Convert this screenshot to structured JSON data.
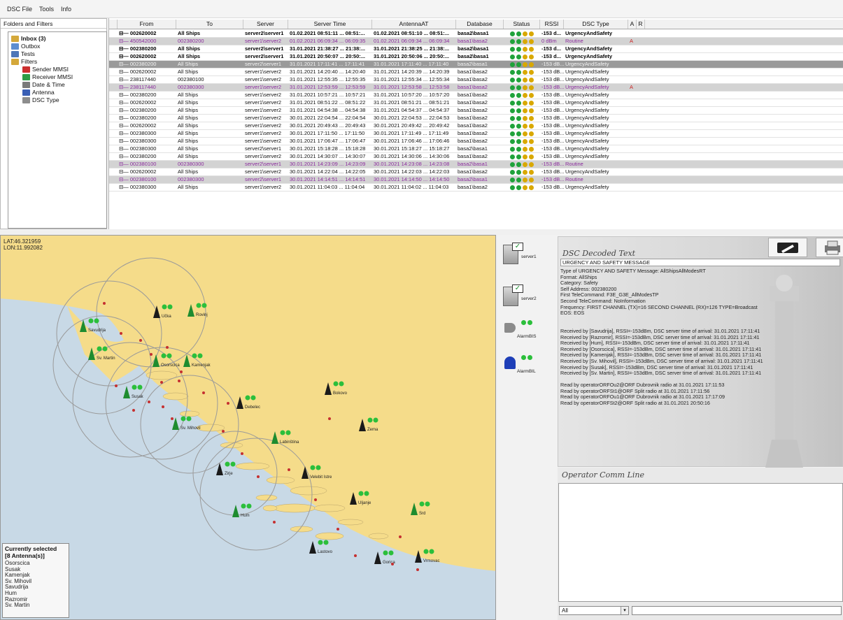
{
  "menu": [
    "DSC File",
    "Tools",
    "Info"
  ],
  "tree": {
    "header": "Folders and Filters",
    "items": [
      {
        "label": "Inbox (3)",
        "bold": true,
        "indent": 0,
        "icon": "folder-icon",
        "color": "#d4a83a"
      },
      {
        "label": "Outbox",
        "bold": false,
        "indent": 0,
        "icon": "outbox-icon",
        "color": "#5d8ed1"
      },
      {
        "label": "Tests",
        "bold": false,
        "indent": 0,
        "icon": "tests-icon",
        "color": "#4e76b8"
      },
      {
        "label": "Filters",
        "bold": false,
        "indent": 0,
        "icon": "filter-icon",
        "color": "#d4a83a"
      },
      {
        "label": "Sender MMSI",
        "bold": false,
        "indent": 1,
        "icon": "anchor-icon",
        "color": "#cc3030"
      },
      {
        "label": "Receiver MMSI",
        "bold": false,
        "indent": 1,
        "icon": "anchor-icon",
        "color": "#2e9d46"
      },
      {
        "label": "Date & Time",
        "bold": false,
        "indent": 1,
        "icon": "clock-icon",
        "color": "#7a7a7a"
      },
      {
        "label": "Antenna",
        "bold": false,
        "indent": 1,
        "icon": "antenna-icon",
        "color": "#3a5fb5"
      },
      {
        "label": "DSC Type",
        "bold": false,
        "indent": 1,
        "icon": "tag-icon",
        "color": "#8d8d8d"
      }
    ]
  },
  "grid": {
    "columns": [
      "",
      "From",
      "To",
      "Server",
      "Server Time",
      "AntennaAT",
      "Database",
      "Status",
      "RSSI",
      "DSC Type",
      "A",
      "R"
    ],
    "rows": [
      {
        "style": "bold",
        "from": "002620002",
        "to": "All Ships",
        "server": "server2\\server1",
        "stime": "01.02.2021 08:51:11 ... 08:51:...",
        "atime": "01.02.2021 08:51:10 ... 08:51:...",
        "db": "basa2\\basa1",
        "rssi": "-153 d...",
        "type": "UrgencyAndSafety",
        "a": ""
      },
      {
        "style": "purple",
        "from": "450542000",
        "to": "002380200",
        "server": "server1\\server2",
        "stime": "01.02.2021 06:09:34 ... 06:09:35",
        "atime": "01.02.2021 06:09:34 ... 06:09:34",
        "db": "basa1\\basa2",
        "rssi": "0 dBm",
        "type": "Routine",
        "a": "A"
      },
      {
        "style": "bold",
        "from": "002380200",
        "to": "All Ships",
        "server": "server2\\server1",
        "stime": "31.01.2021 21:38:27 ... 21:38:...",
        "atime": "31.01.2021 21:38:25 ... 21:38:...",
        "db": "basa2\\basa1",
        "rssi": "-153 d...",
        "type": "UrgencyAndSafety",
        "a": ""
      },
      {
        "style": "bold",
        "from": "002620002",
        "to": "All Ships",
        "server": "server2\\server1",
        "stime": "31.01.2021 20:50:07 ... 20:50:...",
        "atime": "31.01.2021 20:50:06 ... 20:50:...",
        "db": "basa2\\basa1",
        "rssi": "-153 d...",
        "type": "UrgencyAndSafety",
        "a": ""
      },
      {
        "style": "sel",
        "from": "002380200",
        "to": "All Ships",
        "server": "server2\\server1",
        "stime": "31.01.2021 17:11:41 ... 17:11:41",
        "atime": "31.01.2021 17:11:40 ... 17:11:40",
        "db": "basa2\\basa1",
        "rssi": "-153 dB...",
        "type": "UrgencyAndSafety",
        "a": ""
      },
      {
        "style": "",
        "from": "002620002",
        "to": "All Ships",
        "server": "server1\\server2",
        "stime": "31.01.2021 14:20:40 ... 14:20:40",
        "atime": "31.01.2021 14:20:39 ... 14:20:39",
        "db": "basa1\\basa2",
        "rssi": "-153 dB...",
        "type": "UrgencyAndSafety",
        "a": ""
      },
      {
        "style": "",
        "from": "238117440",
        "to": "002380100",
        "server": "server1\\server2",
        "stime": "31.01.2021 12:55:35 ... 12:55:35",
        "atime": "31.01.2021 12:55:34 ... 12:55:34",
        "db": "basa1\\basa2",
        "rssi": "-153 dB...",
        "type": "UrgencyAndSafety",
        "a": ""
      },
      {
        "style": "purple",
        "from": "238117440",
        "to": "002380300",
        "server": "server1\\server2",
        "stime": "31.01.2021 12:53:59 ... 12:53:59",
        "atime": "31.01.2021 12:53:58 ... 12:53:58",
        "db": "basa1\\basa2",
        "rssi": "-153 dB...",
        "type": "UrgencyAndSafety",
        "a": "A"
      },
      {
        "style": "",
        "from": "002380200",
        "to": "All Ships",
        "server": "server1\\server2",
        "stime": "31.01.2021 10:57:21 ... 10:57:21",
        "atime": "31.01.2021 10:57:20 ... 10:57:20",
        "db": "basa1\\basa2",
        "rssi": "-153 dB...",
        "type": "UrgencyAndSafety",
        "a": ""
      },
      {
        "style": "",
        "from": "002620002",
        "to": "All Ships",
        "server": "server1\\server2",
        "stime": "31.01.2021 08:51:22 ... 08:51:22",
        "atime": "31.01.2021 08:51:21 ... 08:51:21",
        "db": "basa1\\basa2",
        "rssi": "-153 dB...",
        "type": "UrgencyAndSafety",
        "a": ""
      },
      {
        "style": "",
        "from": "002380200",
        "to": "All Ships",
        "server": "server1\\server2",
        "stime": "31.01.2021 04:54:38 ... 04:54:38",
        "atime": "31.01.2021 04:54:37 ... 04:54:37",
        "db": "basa1\\basa2",
        "rssi": "-153 dB...",
        "type": "UrgencyAndSafety",
        "a": ""
      },
      {
        "style": "",
        "from": "002380200",
        "to": "All Ships",
        "server": "server1\\server2",
        "stime": "30.01.2021 22:04:54 ... 22:04:54",
        "atime": "30.01.2021 22:04:53 ... 22:04:53",
        "db": "basa1\\basa2",
        "rssi": "-153 dB...",
        "type": "UrgencyAndSafety",
        "a": ""
      },
      {
        "style": "",
        "from": "002620002",
        "to": "All Ships",
        "server": "server1\\server2",
        "stime": "30.01.2021 20:49:43 ... 20:49:43",
        "atime": "30.01.2021 20:49:42 ... 20:49:42",
        "db": "basa1\\basa2",
        "rssi": "-153 dB...",
        "type": "UrgencyAndSafety",
        "a": ""
      },
      {
        "style": "",
        "from": "002380300",
        "to": "All Ships",
        "server": "server1\\server2",
        "stime": "30.01.2021 17:11:50 ... 17:11:50",
        "atime": "30.01.2021 17:11:49 ... 17:11:49",
        "db": "basa1\\basa2",
        "rssi": "-153 dB...",
        "type": "UrgencyAndSafety",
        "a": ""
      },
      {
        "style": "",
        "from": "002380300",
        "to": "All Ships",
        "server": "server1\\server2",
        "stime": "30.01.2021 17:06:47 ... 17:06:47",
        "atime": "30.01.2021 17:06:46 ... 17:06:46",
        "db": "basa1\\basa2",
        "rssi": "-153 dB...",
        "type": "UrgencyAndSafety",
        "a": ""
      },
      {
        "style": "",
        "from": "002380300",
        "to": "All Ships",
        "server": "server2\\server1",
        "stime": "30.01.2021 15:18:28 ... 15:18:28",
        "atime": "30.01.2021 15:18:27 ... 15:18:27",
        "db": "basa2\\basa1",
        "rssi": "-153 dB...",
        "type": "UrgencyAndSafety",
        "a": ""
      },
      {
        "style": "",
        "from": "002380200",
        "to": "All Ships",
        "server": "server1\\server2",
        "stime": "30.01.2021 14:30:07 ... 14:30:07",
        "atime": "30.01.2021 14:30:06 ... 14:30:06",
        "db": "basa1\\basa2",
        "rssi": "-153 dB...",
        "type": "UrgencyAndSafety",
        "a": ""
      },
      {
        "style": "purple",
        "from": "002380100",
        "to": "002380300",
        "server": "server2\\server1",
        "stime": "30.01.2021 14:23:09 ... 14:23:09",
        "atime": "30.01.2021 14:23:08 ... 14:23:08",
        "db": "basa2\\basa1",
        "rssi": "-153 dB...",
        "type": "Routine",
        "a": ""
      },
      {
        "style": "",
        "from": "002620002",
        "to": "All Ships",
        "server": "server1\\server2",
        "stime": "30.01.2021 14:22:04 ... 14:22:05",
        "atime": "30.01.2021 14:22:03 ... 14:22:03",
        "db": "basa1\\basa2",
        "rssi": "-153 dB...",
        "type": "UrgencyAndSafety",
        "a": ""
      },
      {
        "style": "purple",
        "from": "002380100",
        "to": "002380300",
        "server": "server2\\server1",
        "stime": "30.01.2021 14:14:51 ... 14:14:51",
        "atime": "30.01.2021 14:14:50 ... 14:14:50",
        "db": "basa2\\basa1",
        "rssi": "-153 dB...",
        "type": "Routine",
        "a": ""
      },
      {
        "style": "",
        "from": "002380300",
        "to": "All Ships",
        "server": "server1\\server2",
        "stime": "30.01.2021 11:04:03 ... 11:04:04",
        "atime": "30.01.2021 11:04:02 ... 11:04:03",
        "db": "basa1\\basa2",
        "rssi": "-153 dB...",
        "type": "UrgencyAndSafety",
        "a": ""
      }
    ]
  },
  "map": {
    "lat": "LAT:46.321959",
    "lon": "LON:11.992082",
    "sea_color": "#c8d9e6",
    "land_color": "#f5dc8a",
    "antennas": [
      {
        "name": "Savudrija",
        "green": true
      },
      {
        "name": "Učka",
        "green": false
      },
      {
        "name": "Rovinj",
        "green": true
      },
      {
        "name": "Sv. Martin",
        "green": true
      },
      {
        "name": "Kamenjak",
        "green": true
      },
      {
        "name": "Osorscica",
        "green": true
      },
      {
        "name": "Susak",
        "green": true
      },
      {
        "name": "Sv. Mihovil",
        "green": true
      },
      {
        "name": "Debelec",
        "green": false
      },
      {
        "name": "Bokovo",
        "green": false
      },
      {
        "name": "Zema",
        "green": false
      },
      {
        "name": "Labinština",
        "green": true
      },
      {
        "name": "Zirje",
        "green": false
      },
      {
        "name": "Velebit Istre",
        "green": false
      },
      {
        "name": "Hum",
        "green": true
      },
      {
        "name": "Uljanje",
        "green": false
      },
      {
        "name": "Srd",
        "green": true
      },
      {
        "name": "Lastovo",
        "green": false
      },
      {
        "name": "Gorica",
        "green": false
      },
      {
        "name": "Vrmovac",
        "green": false
      }
    ],
    "legend_title": "Currently selected",
    "legend_count": "[8 Antenna(s)]",
    "legend_items": [
      "Osorscica",
      "Susak",
      "Kamenjak",
      "Sv. Mihovil",
      "Savudrija",
      "Hum",
      "Razromir",
      "Sv. Martin"
    ]
  },
  "devices": [
    {
      "label": "server1",
      "icon": "server-icon"
    },
    {
      "label": "server2",
      "icon": "server-icon"
    },
    {
      "label": "AlarmBIS",
      "icon": "speaker-icon"
    },
    {
      "label": "AlarmBIL",
      "icon": "alarm-light-icon"
    }
  ],
  "decoded": {
    "title": "DSC Decoded Text",
    "headline": "URGENCY AND SAFETY MESSAGE",
    "lines": [
      "Type of URGENCY AND SAFETY Message: AllShipsAllModesRT",
      "Format: AllShips",
      "Category: Safety",
      "Self Address: 002380200",
      "First TeleCommand: F3E_G3E_AllModesTP",
      "Second TeleCommand: NoInformation",
      "Frequency: FIRST CHANNEL (TX)=16 SECOND CHANNEL (RX)=126 TYPE=Broadcast",
      "EOS: EOS",
      "",
      "",
      "Received by [Savudrija], RSSI=-153dBm, DSC server time of arrival: 31.01.2021 17:11:41",
      "Received by [Razromir], RSSI=-153dBm, DSC server time of arrival: 31.01.2021 17:11:41",
      "Received by [Hum], RSSI=-153dBm, DSC server time of arrival: 31.01.2021 17:11:41",
      "Received by [Osorscica], RSSI=-153dBm, DSC server time of arrival: 31.01.2021 17:11:41",
      "Received by [Kamenjak], RSSI=-153dBm, DSC server time of arrival: 31.01.2021 17:11:41",
      "Received by [Sv. Mihovil], RSSI=-153dBm, DSC server time of arrival: 31.01.2021 17:11:41",
      "Received by [Susak], RSSI=-153dBm, DSC server time of arrival: 31.01.2021 17:11:41",
      "Received by [Sv. Martin], RSSI=-153dBm, DSC server time of arrival: 31.01.2021 17:11:41",
      "",
      "Read by operatorORFOu2@ORF Dubrovnik radio at 31.01.2021 17:11:53",
      "Read by operatorORFSt1@ORF Split radio at 31.01.2021 17:11:56",
      "Read by operatorORFOu1@ORF Dubrovnik radio at 31.01.2021 17:17:09",
      "Read by operatorORFSt2@ORF Split radio at 31.01.2021 20:50:16"
    ]
  },
  "ops": {
    "title": "Operator Comm Line",
    "select_value": "All"
  }
}
